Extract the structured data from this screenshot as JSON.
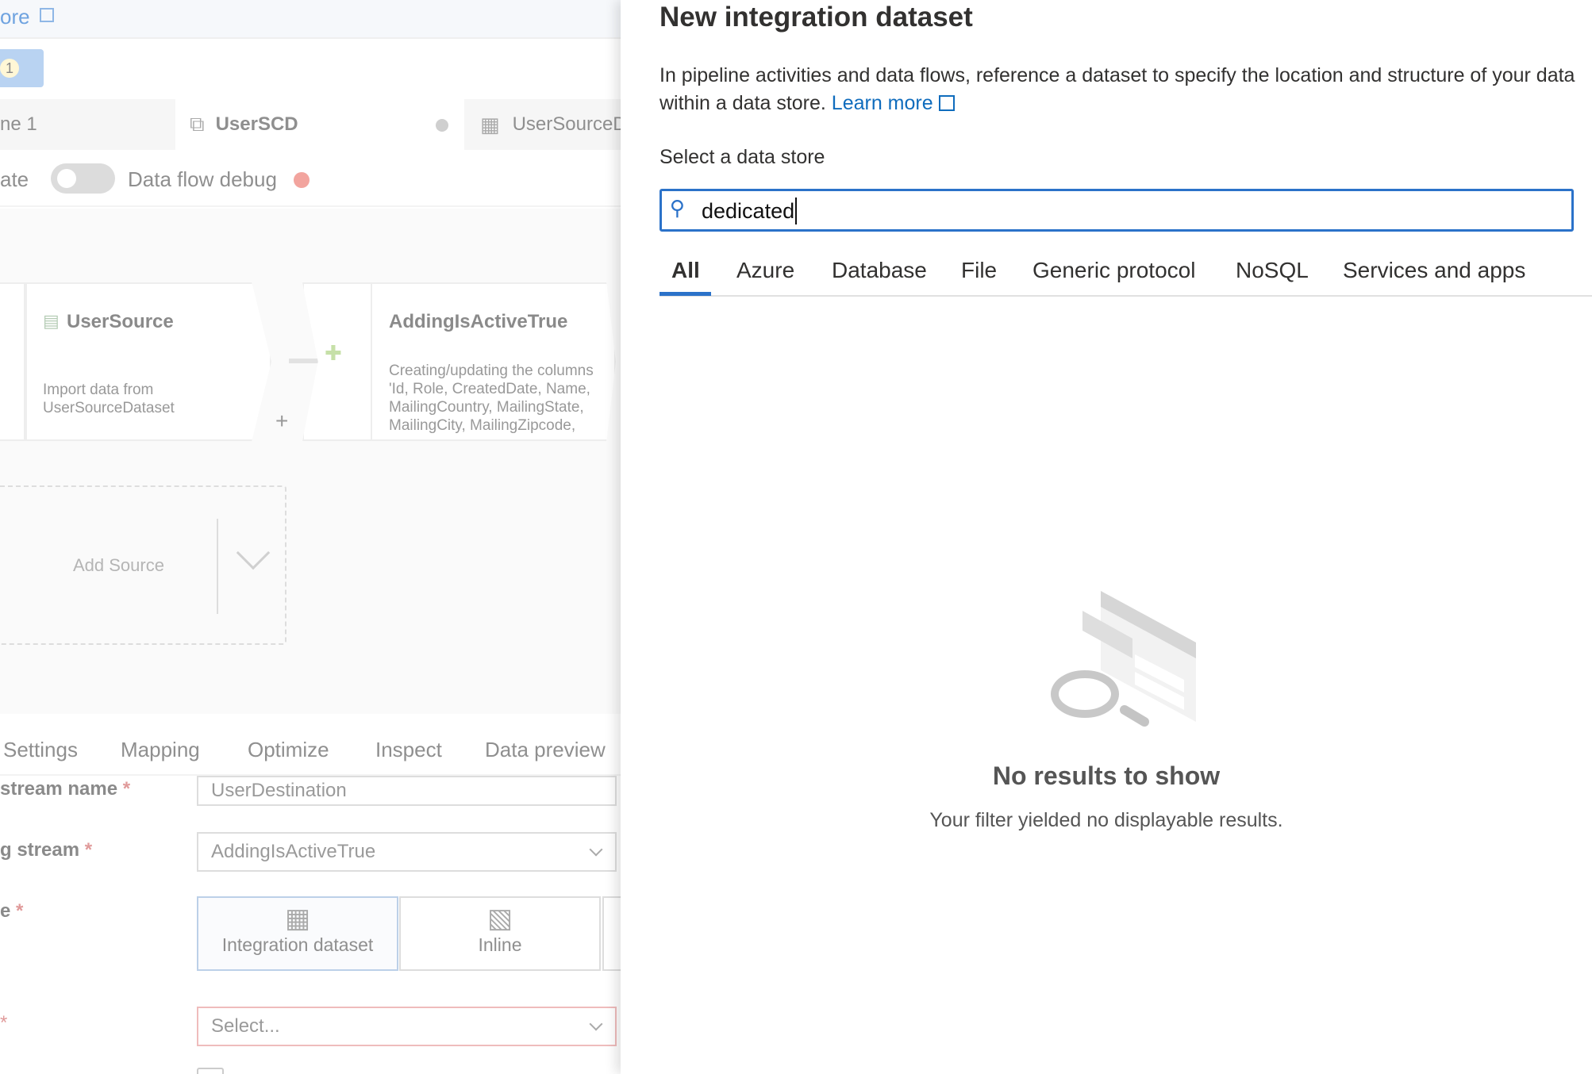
{
  "background": {
    "top_link": "ore",
    "badge_count": "1",
    "tabs": [
      {
        "label": "ne 1"
      },
      {
        "label": "UserSCD",
        "icon": "dataflow-icon",
        "unsaved": true
      },
      {
        "label": "UserSourceD",
        "icon": "table-icon"
      }
    ],
    "toolbar": {
      "partial_label": "ate",
      "debug_label": "Data flow debug",
      "debug_enabled": false,
      "status_color": "#e8473c"
    },
    "canvas": {
      "nodes": [
        {
          "title": "UserSource",
          "description": "Import data from UserSourceDataset"
        },
        {
          "title": "AddingIsActiveTrue",
          "description": "Creating/updating the columns 'Id, Role, CreatedDate, Name, MailingCountry, MailingState, MailingCity, MailingZipcode,"
        }
      ],
      "add_source": "Add Source",
      "plus": "+"
    },
    "settings_tabs": [
      "Settings",
      "Mapping",
      "Optimize",
      "Inspect",
      "Data preview"
    ],
    "form": {
      "stream_name_label": "stream name",
      "stream_name_value": "UserDestination",
      "incoming_label": "g stream",
      "incoming_value": "AddingIsActiveTrue",
      "type_label": "e",
      "type_options": [
        "Integration dataset",
        "Inline"
      ],
      "dataset_label": "",
      "dataset_placeholder": "Select...",
      "required_mark": "*"
    }
  },
  "panel": {
    "title": "New integration dataset",
    "description": "In pipeline activities and data flows, reference a dataset to specify the location and structure of your data within a data store.",
    "learn_more": "Learn more",
    "select_label": "Select a data store",
    "search_value": "dedicated",
    "tabs": [
      "All",
      "Azure",
      "Database",
      "File",
      "Generic protocol",
      "NoSQL",
      "Services and apps"
    ],
    "active_tab": "All",
    "empty_title": "No results to show",
    "empty_subtitle": "Your filter yielded no displayable results.",
    "accent": "#0f6cbd"
  }
}
